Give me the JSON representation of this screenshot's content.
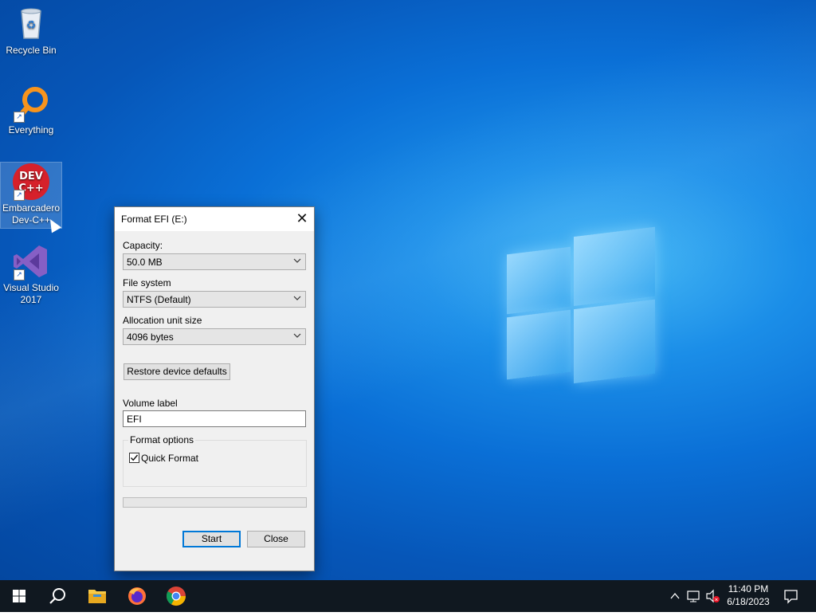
{
  "desktop": {
    "icons": [
      {
        "label": "Recycle Bin"
      },
      {
        "label": "Everything"
      },
      {
        "label": "Embarcadero Dev-C++"
      },
      {
        "label": "Visual Studio 2017"
      }
    ],
    "devcpp_icon_text": "DEV C++"
  },
  "dialog": {
    "title": "Format EFI (E:)",
    "capacity_label": "Capacity:",
    "capacity_value": "50.0 MB",
    "filesystem_label": "File system",
    "filesystem_value": "NTFS (Default)",
    "allocation_label": "Allocation unit size",
    "allocation_value": "4096 bytes",
    "restore_button": "Restore device defaults",
    "volume_label_label": "Volume label",
    "volume_label_value": "EFI",
    "format_options_label": "Format options",
    "quick_format_label": "Quick Format",
    "quick_format_checked": true,
    "progress": 0,
    "start_button": "Start",
    "close_button": "Close"
  },
  "taskbar": {
    "pinned": [
      "start-icon",
      "search-icon",
      "file-explorer-icon",
      "firefox-icon",
      "chrome-icon"
    ],
    "clock_time": "11:40 PM",
    "clock_date": "6/18/2023"
  },
  "colors": {
    "accent": "#0078d7",
    "taskbar": "#101820",
    "dialog_bg": "#f0f0f0"
  }
}
